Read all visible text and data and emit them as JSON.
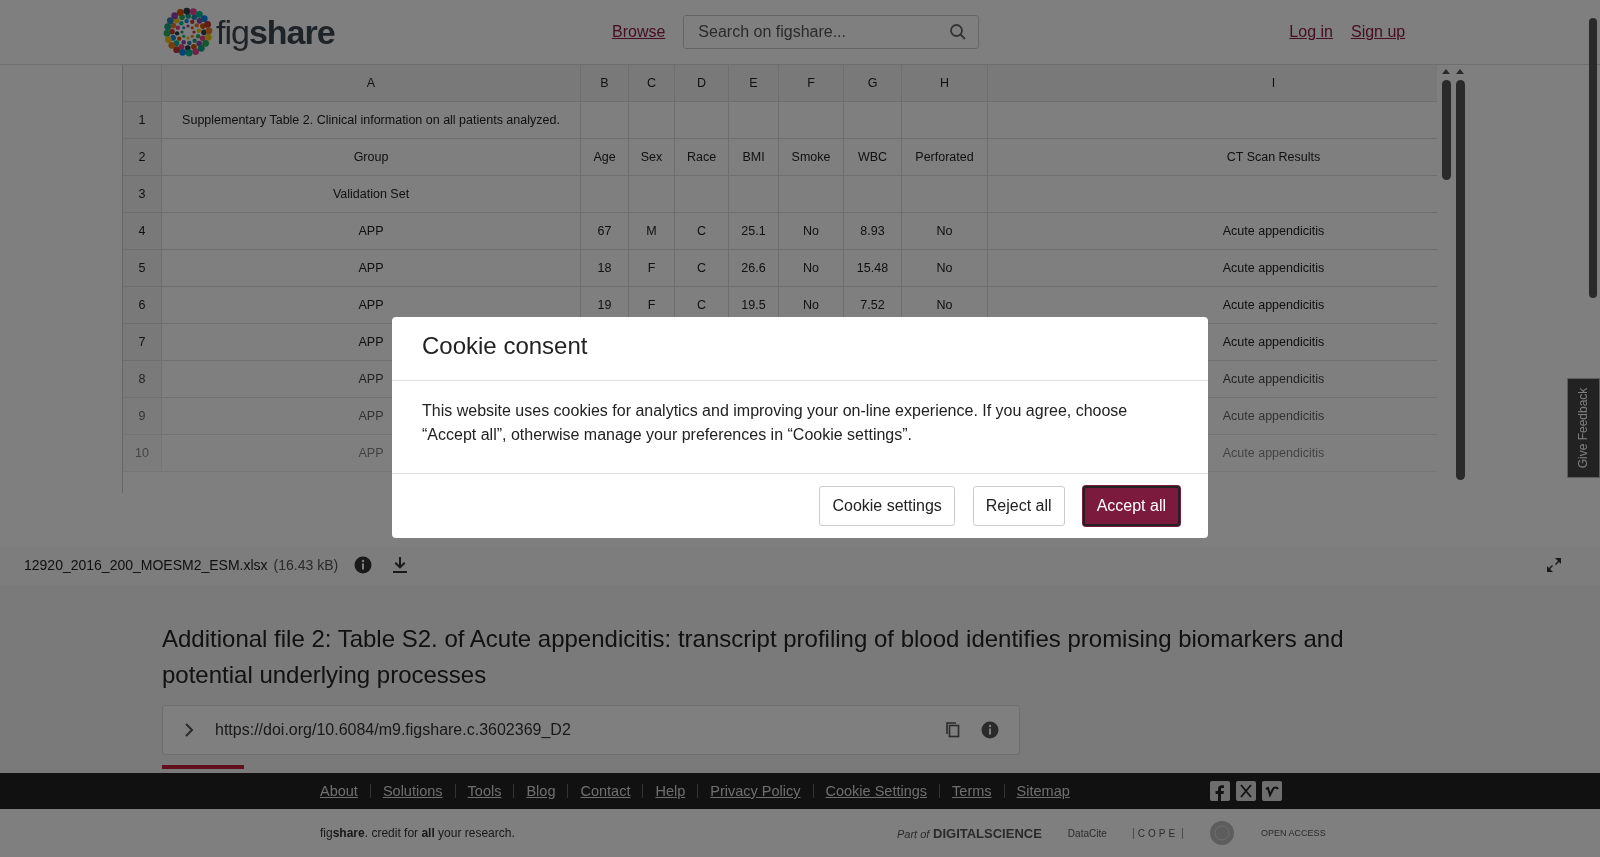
{
  "header": {
    "logo": "fig**share**",
    "browse_link": "Browse",
    "search": {
      "placeholder": "Search on figshare..."
    },
    "auth_links": [
      "Log in",
      "Sign up"
    ]
  },
  "spreadsheet": {
    "columns": [
      "A",
      "B",
      "C",
      "D",
      "E",
      "F",
      "G",
      "H",
      "I"
    ],
    "rows": [
      {
        "number": "1",
        "cells": [
          "Supplementary Table 2. Clinical information on all patients analyzed.",
          null,
          null,
          null,
          null,
          null,
          null,
          null,
          null
        ]
      },
      {
        "number": "2",
        "cells": [
          "Group",
          "Age",
          "Sex",
          "Race",
          "BMI",
          "Smoke",
          "WBC",
          "Perforated",
          "CT Scan Results"
        ]
      },
      {
        "number": "3",
        "cells": [
          "Validation Set",
          null,
          null,
          null,
          null,
          null,
          null,
          null,
          null
        ]
      },
      {
        "number": "4",
        "cells": [
          "APP",
          "67",
          "M",
          "C",
          "25.1",
          "No",
          "8.93",
          "No",
          "Acute appendicitis"
        ]
      },
      {
        "number": "5",
        "cells": [
          "APP",
          "18",
          "F",
          "C",
          "26.6",
          "No",
          "15.48",
          "No",
          "Acute appendicitis"
        ]
      },
      {
        "number": "6",
        "cells": [
          "APP",
          "19",
          "F",
          "C",
          "19.5",
          "No",
          "7.52",
          "No",
          "Acute appendicitis"
        ]
      },
      {
        "number": "7",
        "cells": [
          "APP",
          null,
          null,
          null,
          null,
          null,
          null,
          null,
          "Acute appendicitis"
        ]
      },
      {
        "number": "8",
        "cells": [
          "APP",
          null,
          null,
          null,
          null,
          null,
          null,
          null,
          "Acute appendicitis"
        ]
      },
      {
        "number": "9",
        "cells": [
          "APP",
          null,
          null,
          null,
          null,
          null,
          null,
          null,
          "Acute appendicitis"
        ]
      },
      {
        "number": "10",
        "cells": [
          "APP",
          null,
          null,
          null,
          null,
          null,
          null,
          null,
          "Acute appendicitis"
        ]
      }
    ]
  },
  "file": {
    "name": "12920_2016_200_MOESM2_ESM.xlsx",
    "size": "(16.43 kB)"
  },
  "title": "Additional file 2: Table S2. of Acute appendicitis: transcript profiling of blood identifies promising biomarkers and potential underlying processes",
  "doi": "https://doi.org/10.6084/m9.figshare.c.3602369_D2",
  "feedback": "Give Feedback",
  "footer": {
    "links": [
      "About",
      "Solutions",
      "Tools",
      "Blog",
      "Contact",
      "Help",
      "Privacy Policy",
      "Cookie Settings",
      "Terms",
      "Sitemap"
    ],
    "tagline": "fig**share**. credit for **all** your research.",
    "partners": [
      {
        "kind": "digital-science",
        "prefix": "Part of",
        "name": "DIGITALSCIENCE"
      },
      {
        "kind": "datacite",
        "name": "DataCite"
      },
      {
        "kind": "cope",
        "name": "COPE"
      },
      {
        "kind": "seal"
      },
      {
        "kind": "open-access",
        "name": "OPEN ACCESS"
      }
    ]
  },
  "cookie_dialog": {
    "title": "Cookie consent",
    "message": "This website uses cookies for analytics and improving your on-line experience. If you agree, choose “Accept all”, otherwise manage your preferences in “Cookie settings”.",
    "buttons": [
      {
        "label": "Cookie settings",
        "kind": "secondary"
      },
      {
        "label": "Reject all",
        "kind": "secondary"
      },
      {
        "label": "Accept all",
        "kind": "primary"
      }
    ]
  }
}
